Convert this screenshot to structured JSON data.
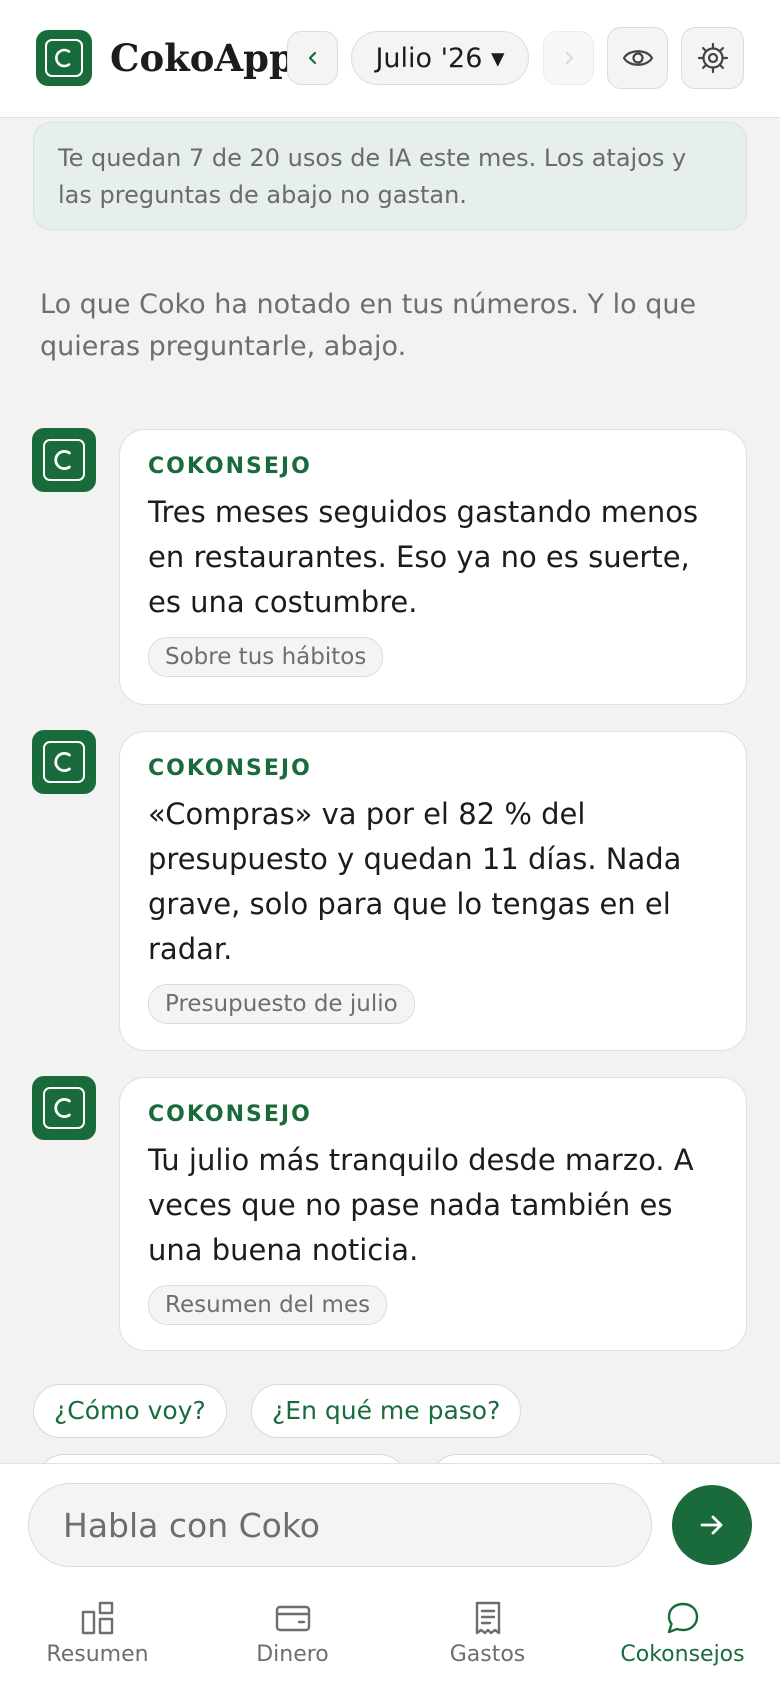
{
  "header": {
    "app_name": "CokoApp",
    "month_label": "Julio '26 ▾",
    "prev_icon": "chevron-left-icon",
    "next_icon": "chevron-right-icon",
    "visibility_icon": "eye-icon",
    "settings_icon": "gear-icon"
  },
  "quota": {
    "text": "Te quedan 7 de 20 usos de IA este mes. Los atajos y las preguntas de abajo no gastan."
  },
  "intro": "Lo que Coko ha notado en tus números. Y lo que quieras preguntarle, abajo.",
  "cards": [
    {
      "label": "COKONSEJO",
      "text": "Tres meses seguidos gastando menos en restaurantes. Eso ya no es suerte, es una costumbre.",
      "tag": "Sobre tus hábitos"
    },
    {
      "label": "COKONSEJO",
      "text": "«Compras» va por el 82 % del presupuesto y quedan 11 días. Nada grave, solo para que lo tengas en el radar.",
      "tag": "Presupuesto de julio"
    },
    {
      "label": "COKONSEJO",
      "text": "Tu julio más tranquilo desde marzo. A veces que no pase nada también es una buena noticia.",
      "tag": "Resumen del mes"
    }
  ],
  "quick_questions": [
    "¿Cómo voy?",
    "¿En qué me paso?"
  ],
  "composer": {
    "placeholder": "Habla con Coko",
    "send_icon": "arrow-right-icon"
  },
  "nav": {
    "items": [
      {
        "label": "Resumen",
        "icon": "dashboard-icon",
        "active": false
      },
      {
        "label": "Dinero",
        "icon": "wallet-icon",
        "active": false
      },
      {
        "label": "Gastos",
        "icon": "receipt-icon",
        "active": false
      },
      {
        "label": "Cokonsejos",
        "icon": "chat-bubble-icon",
        "active": true
      }
    ]
  },
  "colors": {
    "brand": "#1a6b3c",
    "quota_bg": "#e6efeb",
    "background": "#f2f2f2",
    "muted_text": "#6e6e6e"
  }
}
